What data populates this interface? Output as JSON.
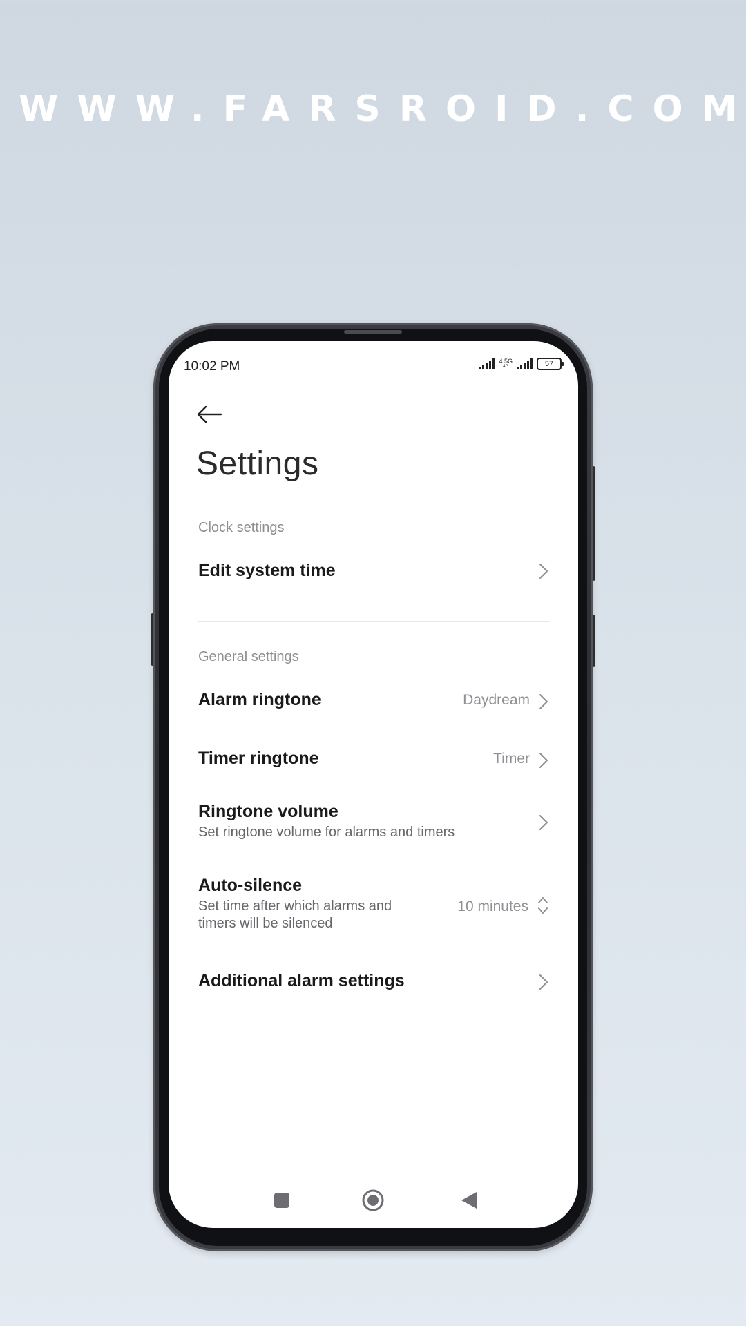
{
  "watermark": "WWW.FARSROID.COM",
  "status_bar": {
    "time": "10:02 PM",
    "network_top": "4.5G",
    "network_bottom": "4G",
    "battery": "57"
  },
  "header": {
    "back_icon": "arrow-left-icon",
    "title": "Settings"
  },
  "sections": {
    "clock": {
      "header": "Clock settings",
      "items": [
        {
          "title": "Edit system time"
        }
      ]
    },
    "general": {
      "header": "General settings",
      "alarm_ringtone": {
        "title": "Alarm ringtone",
        "value": "Daydream"
      },
      "timer_ringtone": {
        "title": "Timer ringtone",
        "value": "Timer"
      },
      "ringtone_volume": {
        "title": "Ringtone volume",
        "subtitle": "Set ringtone volume for alarms and timers"
      },
      "auto_silence": {
        "title": "Auto-silence",
        "subtitle_line1": "Set time after which alarms and",
        "subtitle_line2": "timers will be silenced",
        "value": "10 minutes"
      },
      "additional": {
        "title": "Additional alarm settings"
      }
    }
  },
  "icons": {
    "chevron": "chevron-right-icon",
    "spinner": "chevron-up-down-icon",
    "nav_recents": "square-icon",
    "nav_home": "circle-icon",
    "nav_back": "triangle-back-icon"
  },
  "colors": {
    "background": "#d5dde6",
    "screen": "#ffffff",
    "title_text": "#1a1a1a",
    "secondary_text": "#8e8e93"
  }
}
